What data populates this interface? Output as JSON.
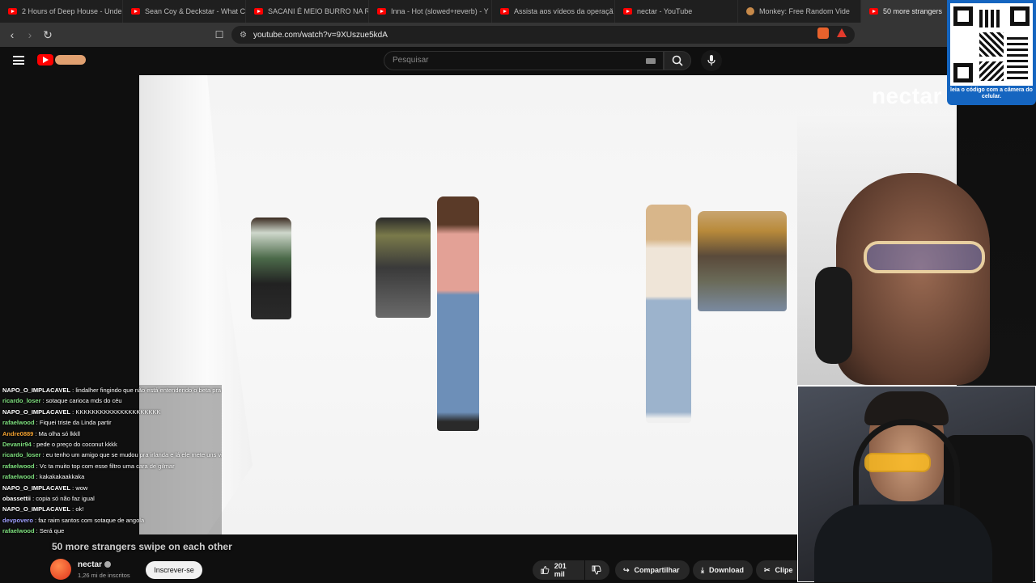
{
  "tabs": [
    {
      "title": "2 Hours of Deep House - Unde"
    },
    {
      "title": "Sean Coy & Deckstar - What C"
    },
    {
      "title": "SACANI É MEIO BURRO NA RE"
    },
    {
      "title": "Inna - Hot (slowed+reverb) - Y"
    },
    {
      "title": "Assista aos vídeos da operaçã"
    },
    {
      "title": "nectar - YouTube"
    },
    {
      "title": "Monkey: Free Random Vide"
    },
    {
      "title": "50 more strangers"
    }
  ],
  "address": {
    "url": "youtube.com/watch?v=9XUszue5kdA"
  },
  "search": {
    "placeholder": "Pesquisar"
  },
  "video": {
    "watermark": "nectar"
  },
  "chat": [
    {
      "user": "NAPO_O_IMPLACAVEL",
      "color": "#ffffff",
      "text": "lindalher fingindo que não está entendendo o beta pra pular"
    },
    {
      "user": "ricardo_loser",
      "color": "#7ee07e",
      "text": "sotaque carioca mds do céu"
    },
    {
      "user": "NAPO_O_IMPLACAVEL",
      "color": "#ffffff",
      "text": "KKKKKKKKKKKKKKKKKKKKK"
    },
    {
      "user": "rafaelwood",
      "color": "#7ee07e",
      "text": "Fiquei triste da Linda partir"
    },
    {
      "user": "Andre0889",
      "color": "#f0a030",
      "text": "Ma olha só lkkll"
    },
    {
      "user": "Devanir94",
      "color": "#7ee07e",
      "text": "pede o preço do coconut kkkk"
    },
    {
      "user": "ricardo_loser",
      "color": "#7ee07e",
      "text": "eu tenho um amigo que se mudou pra irlanda e lá ele mete uns videos assim, só pq mudou de país acha que ficou bonito"
    },
    {
      "user": "rafaelwood",
      "color": "#7ee07e",
      "text": "Vc ta muito top com esse filtro uma cara de gilmar"
    },
    {
      "user": "rafaelwood",
      "color": "#7ee07e",
      "text": "kakakakaakkaka"
    },
    {
      "user": "NAPO_O_IMPLACAVEL",
      "color": "#ffffff",
      "text": "wow"
    },
    {
      "user": "obassettii",
      "color": "#ffffff",
      "text": "copia só não faz igual"
    },
    {
      "user": "NAPO_O_IMPLACAVEL",
      "color": "#ffffff",
      "text": "ok!"
    },
    {
      "user": "devpovero",
      "color": "#9f9fff",
      "text": "faz raim santos com sotaque de angola"
    },
    {
      "user": "rafaelwood",
      "color": "#7ee07e",
      "text": "Será que"
    }
  ],
  "qr": {
    "caption": "leia o código com a câmera do celular."
  },
  "subtitle": "50 more strangers swipe on each other",
  "channel": {
    "name": "nectar",
    "subs": "1,26 mi de inscritos",
    "subscribe": "Inscrever-se"
  },
  "actions": {
    "likes": "201 mil",
    "share": "Compartilhar",
    "download": "Download",
    "clip": "Clipe"
  }
}
